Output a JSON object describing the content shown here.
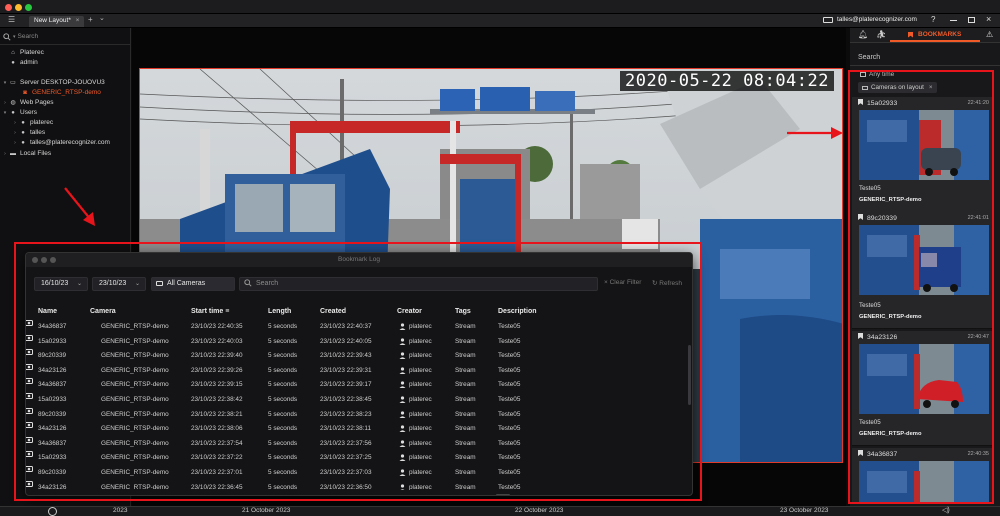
{
  "window": {
    "tab_label": "New Layout*",
    "account": "talles@platerecognizer.com",
    "help": "?"
  },
  "sidebar": {
    "search_placeholder": "Search",
    "items": [
      {
        "label": "Platerec",
        "icon": "home-icon"
      },
      {
        "label": "admin",
        "icon": "user-icon"
      },
      {
        "label": "Server DESKTOP-JOUOVU3",
        "icon": "server-icon"
      },
      {
        "label": "GENERIC_RTSP-demo",
        "icon": "camera-icon"
      },
      {
        "label": "Web Pages",
        "icon": "globe-icon"
      },
      {
        "label": "Users",
        "icon": "users-icon"
      },
      {
        "label": "platerec",
        "icon": "user-icon"
      },
      {
        "label": "talles",
        "icon": "user-icon"
      },
      {
        "label": "talles@platerecognizer.com",
        "icon": "user-icon"
      },
      {
        "label": "Local Files",
        "icon": "folder-icon"
      }
    ]
  },
  "video": {
    "timestamp": "2020-05-22  08:04:22"
  },
  "right_panel": {
    "tab_bookmarks": "BOOKMARKS",
    "search_placeholder": "Search",
    "filter_time": "Any time",
    "filter_cameras": "Cameras on layout",
    "cards": [
      {
        "plate": "15a02933",
        "time": "22:41:20",
        "tag": "Teste05",
        "camera": "GENERIC_RTSP-demo",
        "car_color": "#3a4450"
      },
      {
        "plate": "89c20339",
        "time": "22:41:01",
        "tag": "Teste05",
        "camera": "GENERIC_RTSP-demo",
        "car_color": "#1f3f8a"
      },
      {
        "plate": "34a23126",
        "time": "22:40:47",
        "tag": "Teste05",
        "camera": "GENERIC_RTSP-demo",
        "car_color": "#d11f27"
      },
      {
        "plate": "34a36837",
        "time": "22:40:35",
        "tag": "",
        "camera": "",
        "car_color": "#4a5560"
      }
    ]
  },
  "bookmark_log": {
    "title": "Bookmark Log",
    "date_from": "16/10/23",
    "date_to": "23/10/23",
    "camera_filter": "All Cameras",
    "search_placeholder": "Search",
    "clear_filter": "Clear Filter",
    "refresh": "Refresh",
    "columns": [
      "Name",
      "Camera",
      "Start time",
      "Length",
      "Created",
      "Creator",
      "Tags",
      "Description"
    ],
    "rows": [
      [
        "34a36837",
        "GENERIC_RTSP-demo",
        "23/10/23 22:40:35",
        "5 seconds",
        "23/10/23 22:40:37",
        "platerec",
        "Stream",
        "Teste05"
      ],
      [
        "15a02933",
        "GENERIC_RTSP-demo",
        "23/10/23 22:40:03",
        "5 seconds",
        "23/10/23 22:40:05",
        "platerec",
        "Stream",
        "Teste05"
      ],
      [
        "89c20339",
        "GENERIC_RTSP-demo",
        "23/10/23 22:39:40",
        "5 seconds",
        "23/10/23 22:39:43",
        "platerec",
        "Stream",
        "Teste05"
      ],
      [
        "34a23126",
        "GENERIC_RTSP-demo",
        "23/10/23 22:39:26",
        "5 seconds",
        "23/10/23 22:39:31",
        "platerec",
        "Stream",
        "Teste05"
      ],
      [
        "34a36837",
        "GENERIC_RTSP-demo",
        "23/10/23 22:39:15",
        "5 seconds",
        "23/10/23 22:39:17",
        "platerec",
        "Stream",
        "Teste05"
      ],
      [
        "15a02933",
        "GENERIC_RTSP-demo",
        "23/10/23 22:38:42",
        "5 seconds",
        "23/10/23 22:38:45",
        "platerec",
        "Stream",
        "Teste05"
      ],
      [
        "89c20339",
        "GENERIC_RTSP-demo",
        "23/10/23 22:38:21",
        "5 seconds",
        "23/10/23 22:38:23",
        "platerec",
        "Stream",
        "Teste05"
      ],
      [
        "34a23126",
        "GENERIC_RTSP-demo",
        "23/10/23 22:38:06",
        "5 seconds",
        "23/10/23 22:38:11",
        "platerec",
        "Stream",
        "Teste05"
      ],
      [
        "34a36837",
        "GENERIC_RTSP-demo",
        "23/10/23 22:37:54",
        "5 seconds",
        "23/10/23 22:37:56",
        "platerec",
        "Stream",
        "Teste05"
      ],
      [
        "15a02933",
        "GENERIC_RTSP-demo",
        "23/10/23 22:37:22",
        "5 seconds",
        "23/10/23 22:37:25",
        "platerec",
        "Stream",
        "Teste05"
      ],
      [
        "89c20339",
        "GENERIC_RTSP-demo",
        "23/10/23 22:37:01",
        "5 seconds",
        "23/10/23 22:37:03",
        "platerec",
        "Stream",
        "Teste05"
      ],
      [
        "34a23126",
        "GENERIC_RTSP-demo",
        "23/10/23 22:36:45",
        "5 seconds",
        "23/10/23 22:36:50",
        "platerec",
        "Stream",
        "Teste05"
      ]
    ]
  },
  "timeline": {
    "year": "2023",
    "labels": [
      "21 October 2023",
      "22 October 2023",
      "23 October 2023"
    ]
  },
  "colors": {
    "accent": "#f05a28",
    "annotation": "#e8141b",
    "server_active": "#f05a28"
  }
}
